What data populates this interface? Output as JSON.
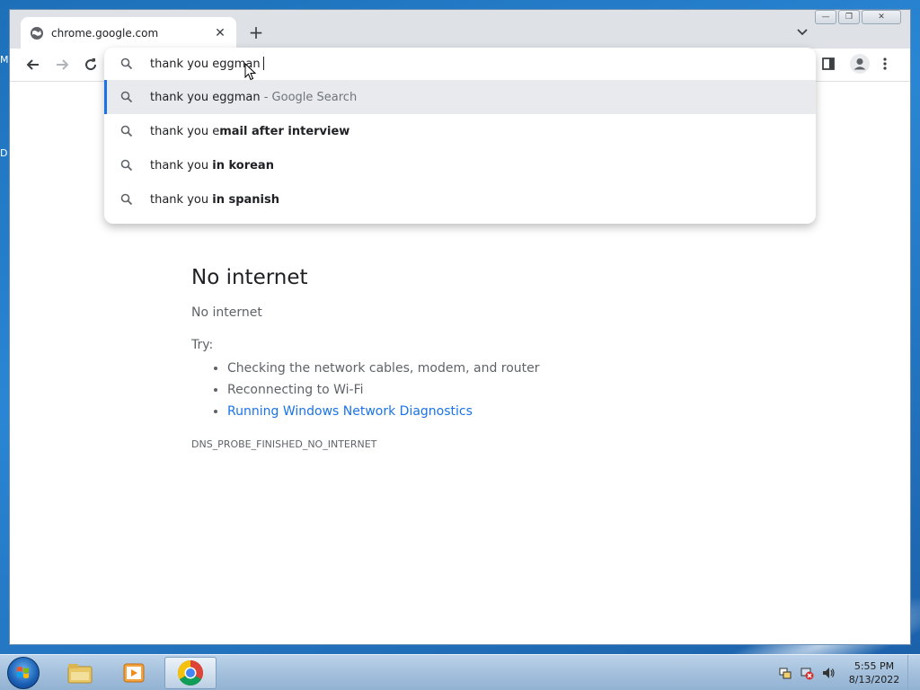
{
  "desktop": {
    "edge_text_1": "M",
    "edge_text_2": "D"
  },
  "browser": {
    "tab": {
      "title": "chrome.google.com",
      "close_glyph": "✕"
    },
    "new_tab_glyph": "+",
    "window_controls": {
      "minimize": "—",
      "restore": "❐",
      "close": "✕"
    }
  },
  "omnibox": {
    "typed_text": "thank you eggman",
    "suggestions": [
      {
        "prefix": "thank you eggman",
        "bold": "",
        "suffix": " - Google Search",
        "selected": true
      },
      {
        "prefix": "thank you e",
        "bold": "mail after interview",
        "suffix": "",
        "selected": false
      },
      {
        "prefix": "thank you ",
        "bold": "in korean",
        "suffix": "",
        "selected": false
      },
      {
        "prefix": "thank you ",
        "bold": "in spanish",
        "suffix": "",
        "selected": false
      }
    ]
  },
  "error_page": {
    "title": "No internet",
    "subtitle": "No internet",
    "try_label": "Try:",
    "tips": [
      "Checking the network cables, modem, and router",
      "Reconnecting to Wi-Fi"
    ],
    "diagnostics_link": "Running Windows Network Diagnostics",
    "error_code": "DNS_PROBE_FINISHED_NO_INTERNET"
  },
  "taskbar": {
    "time": "5:55 PM",
    "date": "8/13/2022"
  },
  "colors": {
    "accent": "#1a73e8",
    "link": "#1a73e8",
    "selected_row": "#e8eaed"
  }
}
